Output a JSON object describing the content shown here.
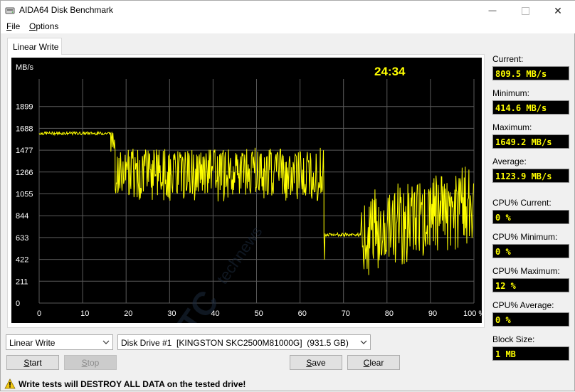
{
  "window": {
    "title": "AIDA64 Disk Benchmark",
    "minimize_symbol": "—",
    "close_symbol": "✕"
  },
  "menu": {
    "file": "File",
    "options": "Options"
  },
  "tab": {
    "label": "Linear Write"
  },
  "chart_data": {
    "type": "line",
    "ylabel": "MB/s",
    "timer": "24:34",
    "ylim": [
      0,
      2110
    ],
    "xlim": [
      0,
      100
    ],
    "y_ticks": [
      "1899",
      "1688",
      "1477",
      "1266",
      "1055",
      "844",
      "633",
      "422",
      "211",
      "0"
    ],
    "x_ticks": [
      "0",
      "10",
      "20",
      "30",
      "40",
      "50",
      "60",
      "70",
      "80",
      "90",
      "100 %"
    ],
    "grid": true,
    "line_color": "#ffff00",
    "series": [
      {
        "segments": [
          {
            "x_start": 0,
            "x_end": 16.5,
            "base": 1640,
            "spread": 15,
            "dip_chance": 0
          },
          {
            "x_start": 16.5,
            "x_end": 17.5,
            "base": 1560,
            "spread": 100,
            "dip_chance": 0
          },
          {
            "x_start": 17.5,
            "x_end": 65.5,
            "base": 1260,
            "spread": 200,
            "dip_chance": 0.5
          },
          {
            "x_start": 65.5,
            "x_end": 74,
            "base": 660,
            "spread": 15,
            "dip_chance": 0.1
          },
          {
            "x_start": 74,
            "x_end": 100,
            "base_start": 680,
            "base_end": 1000,
            "spread": 320,
            "dip_chance": 0.5
          }
        ]
      }
    ]
  },
  "stats": {
    "current_label": "Current:",
    "current_value": "809.5 MB/s",
    "minimum_label": "Minimum:",
    "minimum_value": "414.6 MB/s",
    "maximum_label": "Maximum:",
    "maximum_value": "1649.2 MB/s",
    "average_label": "Average:",
    "average_value": "1123.9 MB/s",
    "cpu_current_label": "CPU% Current:",
    "cpu_current_value": "0 %",
    "cpu_minimum_label": "CPU% Minimum:",
    "cpu_minimum_value": "0 %",
    "cpu_maximum_label": "CPU% Maximum:",
    "cpu_maximum_value": "12 %",
    "cpu_average_label": "CPU% Average:",
    "cpu_average_value": "0 %",
    "block_size_label": "Block Size:",
    "block_size_value": "1 MB"
  },
  "controls": {
    "test_select": "Linear Write",
    "drive_select": "Disk Drive #1  [KINGSTON SKC2500M81000G]  (931.5 GB)",
    "start": "Start",
    "stop": "Stop",
    "save": "Save",
    "clear": "Clear"
  },
  "warning": {
    "text": "Write tests will DESTROY ALL DATA on the tested drive!"
  },
  "colors": {
    "accent_yellow": "#ffff00",
    "chart_bg": "#000000",
    "grid": "#5a5a5a",
    "warning_yellow": "#f2c811"
  }
}
